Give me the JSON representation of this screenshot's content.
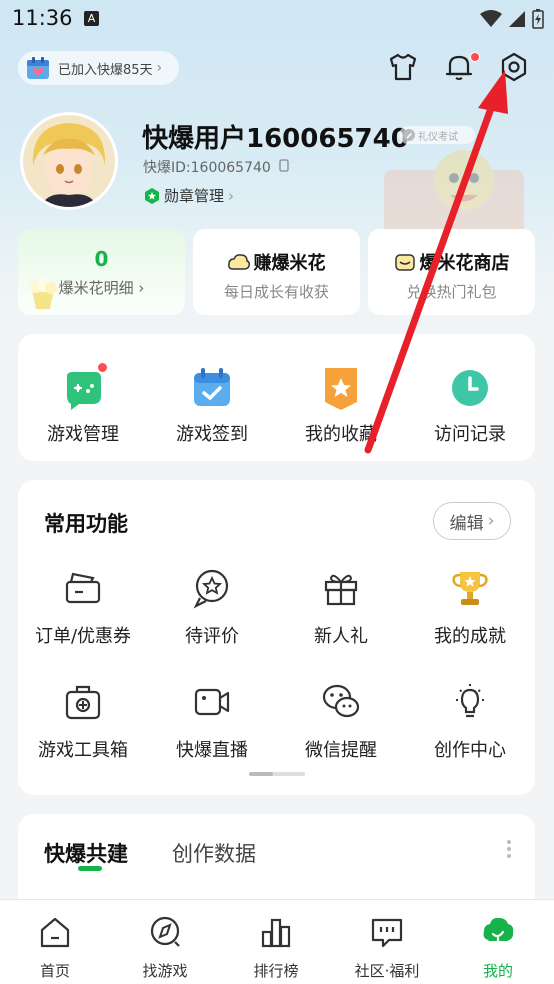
{
  "status_bar": {
    "time": "11:36",
    "a_icon": "A"
  },
  "header": {
    "join_text": "已加入快爆85天",
    "icons": [
      "tshirt-icon",
      "bell-icon",
      "settings-icon"
    ]
  },
  "profile": {
    "username": "快爆用户160065740",
    "tag": "礼仪考试",
    "user_id": "快爆ID:160065740",
    "badge_label": "勋章管理"
  },
  "stats": [
    {
      "value": "0",
      "label": "爆米花明细"
    },
    {
      "title": "赚爆米花",
      "sub": "每日成长有收获"
    },
    {
      "title": "爆米花商店",
      "sub": "兑换热门礼包"
    }
  ],
  "quick": [
    {
      "label": "游戏管理",
      "icon": "gamepad-icon"
    },
    {
      "label": "游戏签到",
      "icon": "calendar-check-icon"
    },
    {
      "label": "我的收藏",
      "icon": "star-badge-icon"
    },
    {
      "label": "访问记录",
      "icon": "clock-icon"
    }
  ],
  "functions": {
    "title": "常用功能",
    "edit_label": "编辑",
    "items": [
      {
        "label": "订单/优惠券",
        "icon": "coupon-icon"
      },
      {
        "label": "待评价",
        "icon": "review-icon"
      },
      {
        "label": "新人礼",
        "icon": "gift-icon"
      },
      {
        "label": "我的成就",
        "icon": "trophy-icon"
      },
      {
        "label": "游戏工具箱",
        "icon": "toolbox-icon"
      },
      {
        "label": "快爆直播",
        "icon": "video-icon"
      },
      {
        "label": "微信提醒",
        "icon": "wechat-icon"
      },
      {
        "label": "创作中心",
        "icon": "lightbulb-icon"
      }
    ]
  },
  "build": {
    "tab_active": "快爆共建",
    "tab_other": "创作数据"
  },
  "bottom_nav": [
    {
      "label": "首页",
      "icon": "home-icon"
    },
    {
      "label": "找游戏",
      "icon": "compass-icon"
    },
    {
      "label": "排行榜",
      "icon": "chart-icon"
    },
    {
      "label": "社区·福利",
      "icon": "community-icon"
    },
    {
      "label": "我的",
      "icon": "me-icon"
    }
  ],
  "colors": {
    "accent": "#16b24c",
    "arrow": "#e8202a"
  }
}
